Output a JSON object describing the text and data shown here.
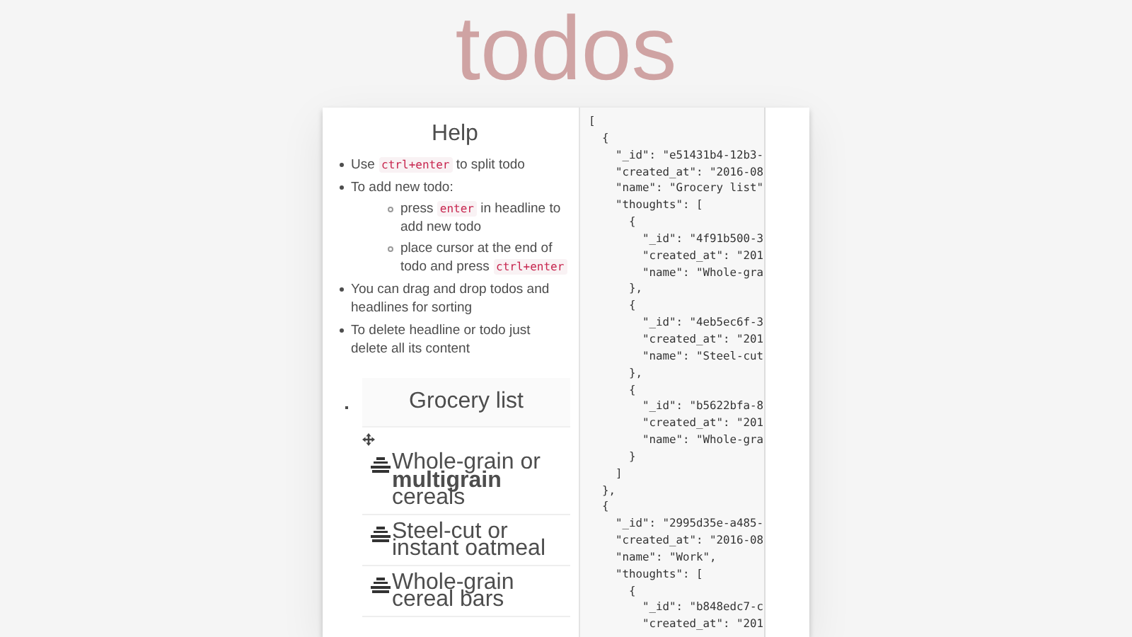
{
  "app_title": "todos",
  "help": {
    "title": "Help",
    "items": [
      {
        "segments": [
          {
            "kind": "text",
            "text": "Use "
          },
          {
            "kind": "code",
            "text": "ctrl+enter"
          },
          {
            "kind": "text",
            "text": " to split todo"
          }
        ]
      },
      {
        "segments": [
          {
            "kind": "text",
            "text": "To add new todo:"
          }
        ],
        "children": [
          {
            "segments": [
              {
                "kind": "text",
                "text": "press "
              },
              {
                "kind": "code",
                "text": "enter"
              },
              {
                "kind": "text",
                "text": " in headline to add new todo"
              }
            ]
          },
          {
            "segments": [
              {
                "kind": "text",
                "text": "place cursor at the end of todo and press "
              },
              {
                "kind": "code",
                "text": "ctrl+enter"
              }
            ]
          }
        ]
      },
      {
        "segments": [
          {
            "kind": "text",
            "text": "You can drag and drop todos and headlines for sorting"
          }
        ]
      },
      {
        "segments": [
          {
            "kind": "text",
            "text": "To delete headline or todo just delete all its content"
          }
        ]
      }
    ]
  },
  "lists": [
    {
      "headline": "Grocery list",
      "todos": [
        {
          "text": "Whole-grain or **multigrain** cereals"
        },
        {
          "text": "Steel-cut or instant oatmeal"
        },
        {
          "text": "Whole-grain cereal bars"
        }
      ]
    }
  ],
  "json_lines": [
    "[",
    "  {",
    "    \"_id\": \"e51431b4-12b3-",
    "    \"created_at\": \"2016-08",
    "    \"name\": \"Grocery list\"",
    "    \"thoughts\": [",
    "      {",
    "        \"_id\": \"4f91b500-3",
    "        \"created_at\": \"201",
    "        \"name\": \"Whole-gra",
    "      },",
    "      {",
    "        \"_id\": \"4eb5ec6f-3",
    "        \"created_at\": \"201",
    "        \"name\": \"Steel-cut",
    "      },",
    "      {",
    "        \"_id\": \"b5622bfa-8",
    "        \"created_at\": \"201",
    "        \"name\": \"Whole-gra",
    "      }",
    "    ]",
    "  },",
    "  {",
    "    \"_id\": \"2995d35e-a485-",
    "    \"created_at\": \"2016-08",
    "    \"name\": \"Work\",",
    "    \"thoughts\": [",
    "      {",
    "        \"_id\": \"b848edc7-c",
    "        \"created_at\": \"201"
  ]
}
